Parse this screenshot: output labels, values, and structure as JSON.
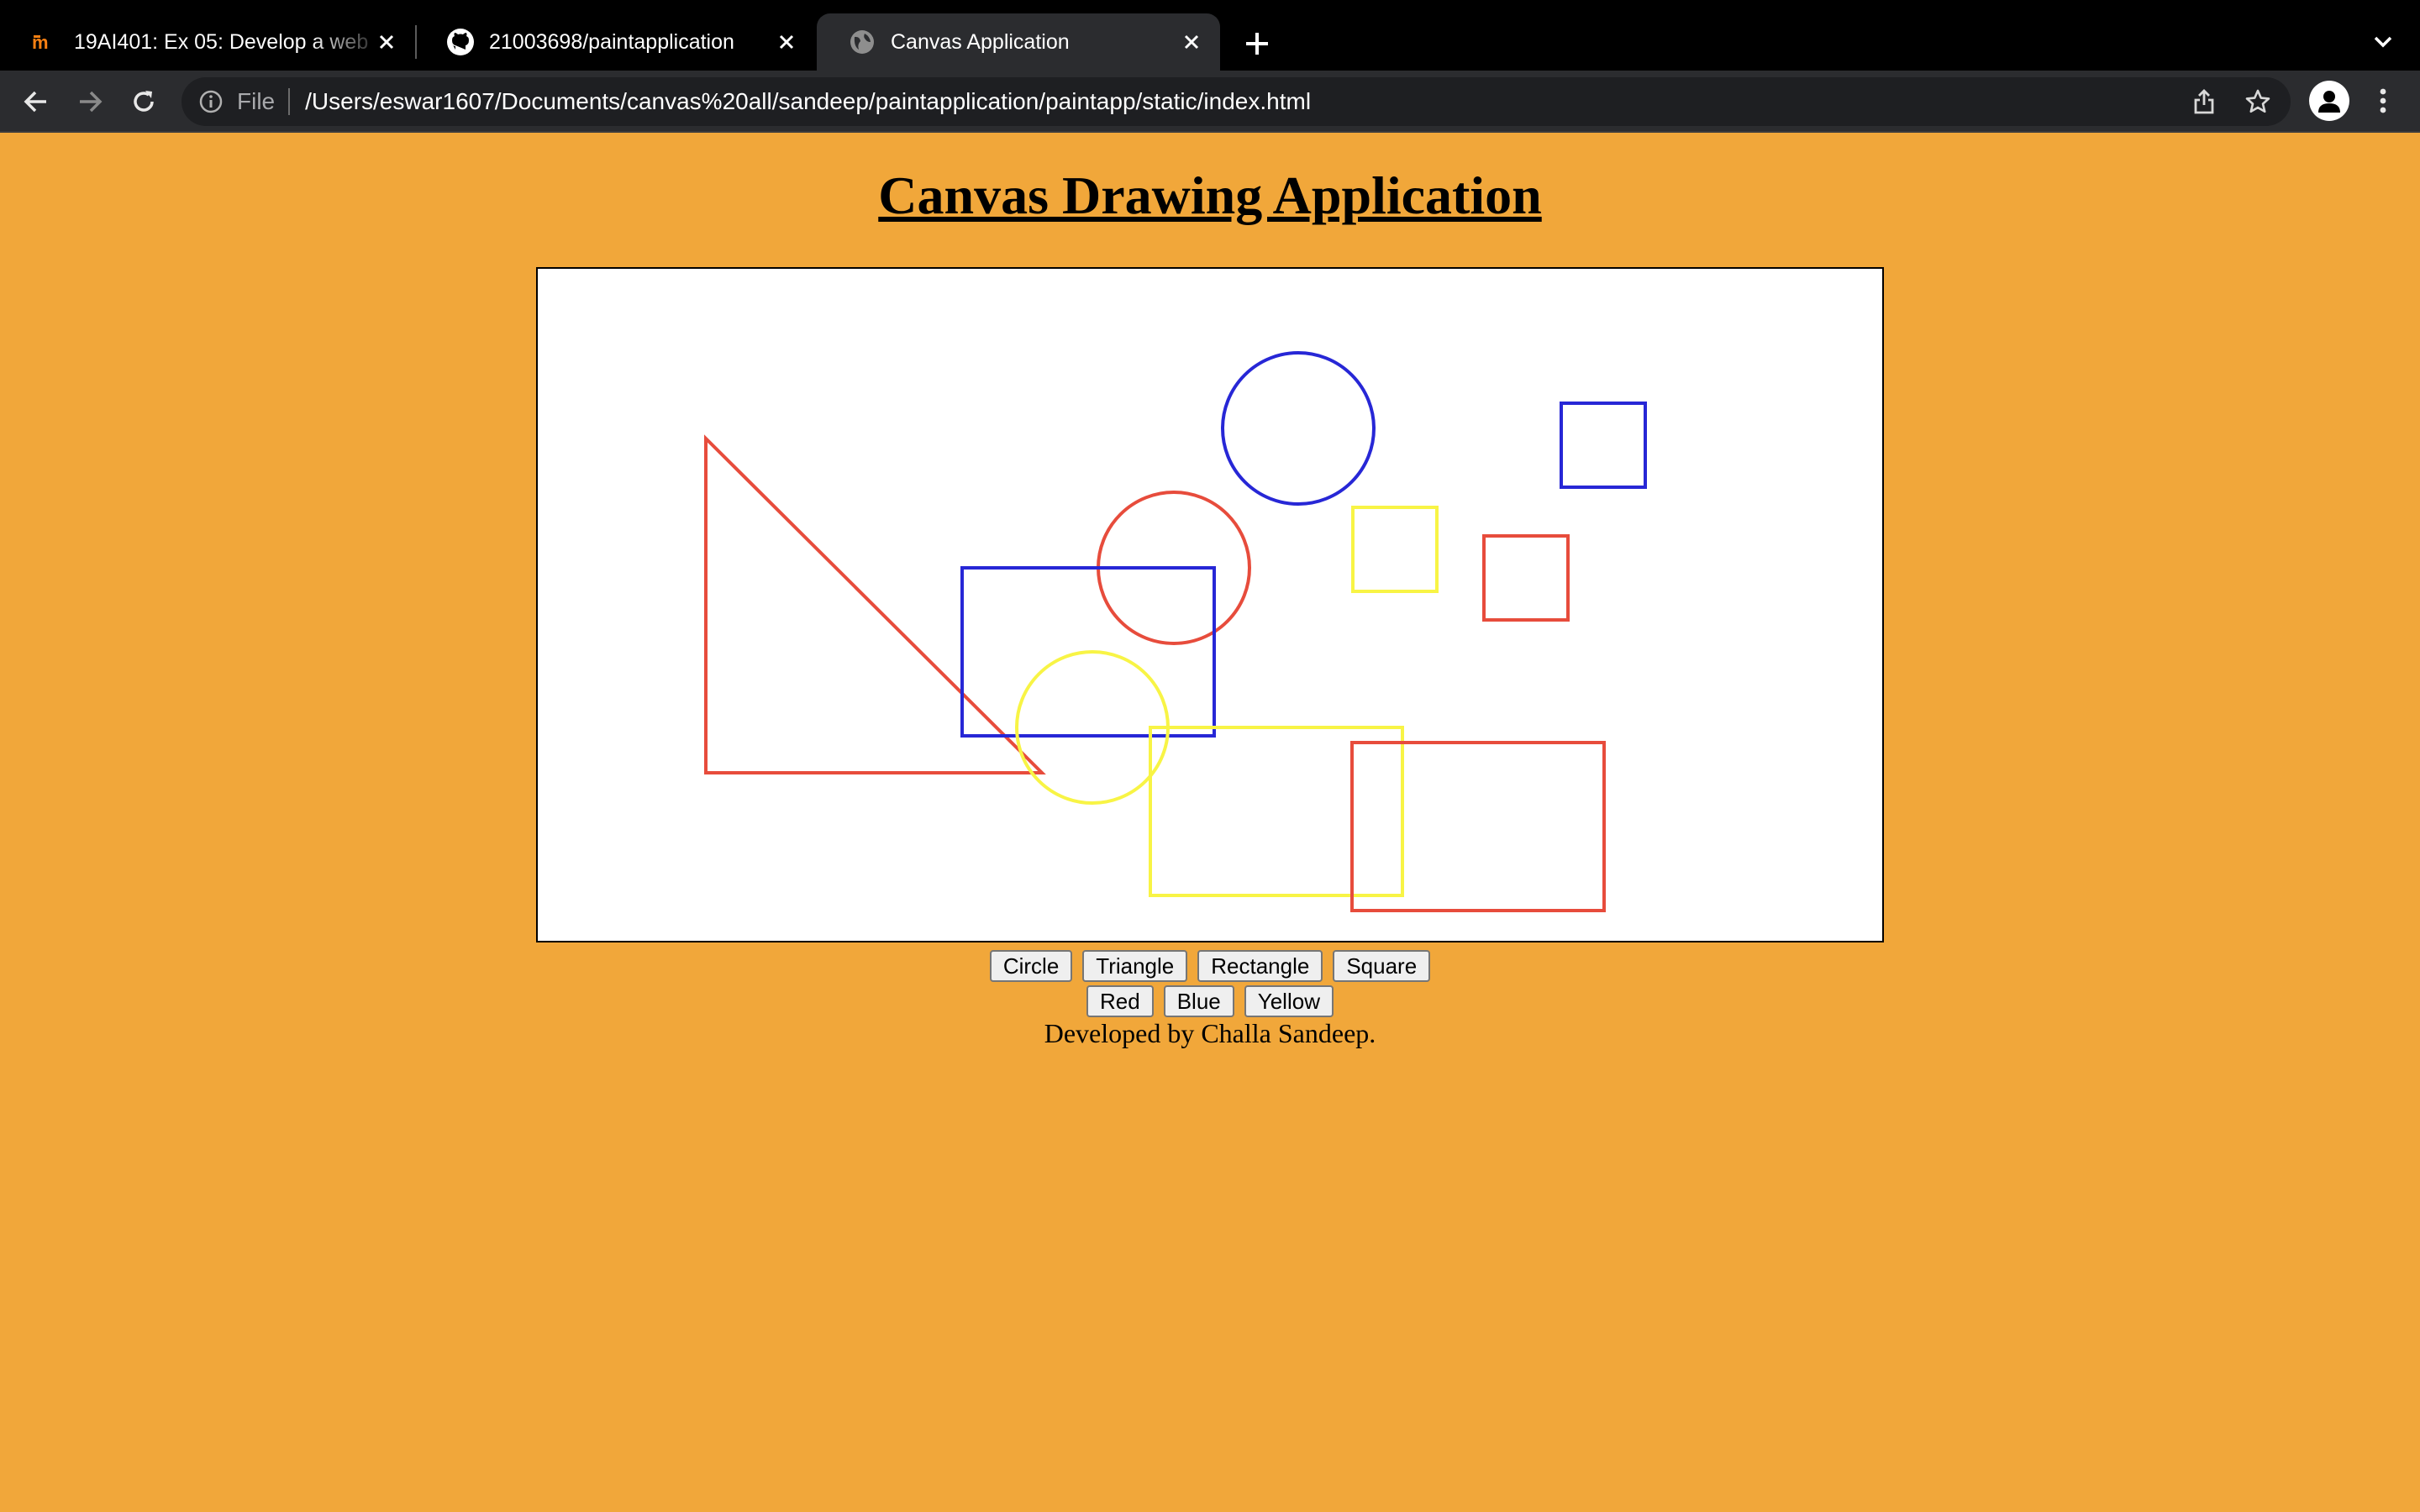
{
  "browser": {
    "tabs": [
      {
        "title": "19AI401: Ex 05: Develop a web",
        "favicon": "moodle-icon",
        "active": false
      },
      {
        "title": "21003698/paintapplication",
        "favicon": "github-icon",
        "active": false
      },
      {
        "title": "Canvas Application",
        "favicon": "globe-icon",
        "active": true
      }
    ],
    "address": {
      "scheme": "File",
      "url": "/Users/eswar1607/Documents/canvas%20all/sandeep/paintapplication/paintapp/static/index.html"
    }
  },
  "page": {
    "heading": "Canvas Drawing Application",
    "shape_buttons": [
      "Circle",
      "Triangle",
      "Rectangle",
      "Square"
    ],
    "color_buttons": [
      "Red",
      "Blue",
      "Yellow"
    ],
    "footer": "Developed by Challa Sandeep."
  },
  "colors": {
    "page_background": "#f1a73a",
    "red": "#e74c3c",
    "blue": "#2727d6",
    "yellow": "#f8f445"
  },
  "canvas_shapes": [
    {
      "type": "triangle",
      "color": "red"
    },
    {
      "type": "circle",
      "color": "blue"
    },
    {
      "type": "square",
      "color": "blue"
    },
    {
      "type": "circle",
      "color": "red"
    },
    {
      "type": "square",
      "color": "yellow"
    },
    {
      "type": "square",
      "color": "red"
    },
    {
      "type": "rectangle",
      "color": "blue"
    },
    {
      "type": "circle",
      "color": "yellow"
    },
    {
      "type": "rectangle",
      "color": "yellow"
    },
    {
      "type": "rectangle",
      "color": "red"
    }
  ]
}
